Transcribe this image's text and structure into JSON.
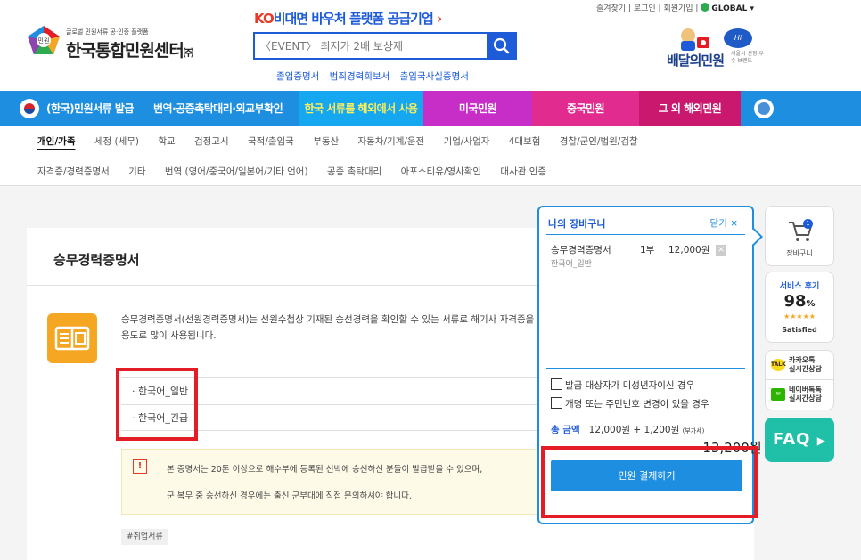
{
  "header": {
    "util_links": [
      "즐겨찾기",
      "로그인",
      "회원가입"
    ],
    "global_label": "GLOBAL",
    "logo_sub": "글로벌 민원서류 공·인증 플랫폼",
    "logo_name": "한국통합민원센터",
    "logo_suffix": "㈜",
    "banner_ko": "KO",
    "banner_text": "비대면 바우처 플랫폼 공급기업",
    "search_placeholder": "〈EVENT〉 최저가 2배 보상제",
    "quick_links": [
      "졸업증명서",
      "범죄경력회보서",
      "출입국사실증명서"
    ],
    "badge_title": "배달의민원",
    "badge_seoul": "Hi Seoul",
    "badge_small": "서울시 선정 우수 브랜드"
  },
  "nav": {
    "items": [
      "(한국)민원서류 발급",
      "번역·공증촉탁대리·외교부확인",
      "한국 서류를 해외에서 사용",
      "미국민원",
      "중국민원",
      "그 외 해외민원"
    ]
  },
  "subnav": {
    "row1": [
      "개인/가족",
      "세정 (세무)",
      "학교",
      "검정고시",
      "국적/출입국",
      "부동산",
      "자동차/기계/운전",
      "기업/사업자",
      "4대보험",
      "경찰/군인/법원/검찰"
    ],
    "row2": [
      "자격증/경력증명서",
      "기타",
      "번역 (영어/중국어/일본어/기타 언어)",
      "공증 촉탁대리",
      "아포스티유/영사확인",
      "대사관 인증"
    ]
  },
  "content": {
    "title": "승무경력증명서",
    "description": "승무경력증명서(선원경력증명서)는 선원수첩상 기재된 승선경력을 확인할 수 있는 서류로 해기사 자격증을 용도로 많이 사용됩니다.",
    "variants": [
      "한국어_일반",
      "한국어_긴급"
    ],
    "notice_line1": "본 증명서는 20톤 이상으로 해수부에 등록된 선박에 승선하신 분들이 발급받을 수 있으며,",
    "notice_line2": "군 복무 중 승선하신 경우에는 출신 군부대에 직접 문의하셔야 합니다.",
    "tag": "#취업서류"
  },
  "cart": {
    "title": "나의 장바구니",
    "close_label": "닫기 ×",
    "item_name": "승무경력증명서",
    "item_type": "한국어_일반",
    "item_qty": "1부",
    "item_price": "12,000원",
    "check1": "발급 대상자가 미성년자이신 경우",
    "check2": "개명 또는 주민번호 변경이 있을 경우",
    "total_label": "총 금액",
    "total_formula": "12,000원 + 1,200원",
    "total_vat": "(부가세)",
    "total_sum": "= 13,200원",
    "pay_button": "민원 결제하기"
  },
  "rail": {
    "cart_label": "장바구니",
    "cart_count": "1",
    "review_title": "서비스 후기",
    "review_score": "98",
    "review_unit": "%",
    "review_stars": "★★★★★",
    "review_status": "Satisfied",
    "kakao_line1": "카카오톡",
    "kakao_line2": "실시간상담",
    "kakao_icon": "TALK",
    "naver_line1": "네이버톡톡",
    "naver_line2": "실시간상담",
    "faq": "FAQ"
  },
  "colors": {
    "brand_blue": "#1d8ee0",
    "accent_red": "#e31c25",
    "nav_usa": "#c72ec8",
    "nav_china": "#e22b8e",
    "nav_etc": "#c9186e"
  }
}
